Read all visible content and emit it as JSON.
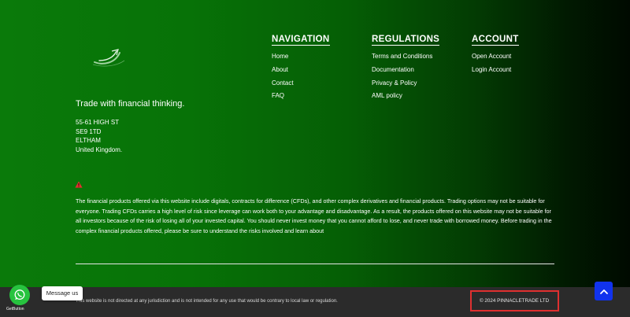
{
  "brand": {
    "logo_icon": "swoosh-logo-icon",
    "tagline": "Trade with financial thinking.",
    "address": [
      "55-61 HIGH ST",
      "SE9 1TD",
      "ELTHAM",
      "United Kingdom."
    ]
  },
  "navigation": {
    "title": "NAVIGATION",
    "items": [
      "Home",
      "About",
      "Contact",
      "FAQ"
    ]
  },
  "regulations": {
    "title": "REGULATIONS",
    "items": [
      "Terms and Conditions",
      "Documentation",
      "Privacy & Policy",
      "AML policy"
    ]
  },
  "account": {
    "title": "ACCOUNT",
    "items": [
      "Open Account",
      "Login Account"
    ]
  },
  "risk": {
    "icon": "warning-triangle-icon",
    "disclaimer": "The financial products offered via this website include digitals, contracts for difference (CFDs), and other complex derivatives and financial products. Trading options may not be suitable for everyone. Trading CFDs carries a high level of risk since leverage can work both to your advantage and disadvantage. As a result, the products offered on this website may not be suitable for all investors because of the risk of losing all of your invested capital. You should never invest money that you cannot afford to lose, and never trade with borrowed money. Before trading in the complex financial products offered, please be sure to understand the risks involved and learn about"
  },
  "bottom": {
    "legal": "This website is not directed at any jurisdiction and is not intended for any use that would be contrary to local law or regulation.",
    "copyright": "© 2024 PINNACLETRADE LTD"
  },
  "widgets": {
    "scroll_top_icon": "chevron-up-icon",
    "whatsapp_icon": "whatsapp-icon",
    "message_label": "Message us",
    "getbutton_label": "GetButton"
  },
  "colors": {
    "footer_green": "#0a7a0a",
    "bottom_bar": "#2b2b2b",
    "highlight_red": "#e03030",
    "scroll_button_blue": "#1133ee",
    "whatsapp_green": "#27c33f",
    "warning_red": "#e03030"
  }
}
